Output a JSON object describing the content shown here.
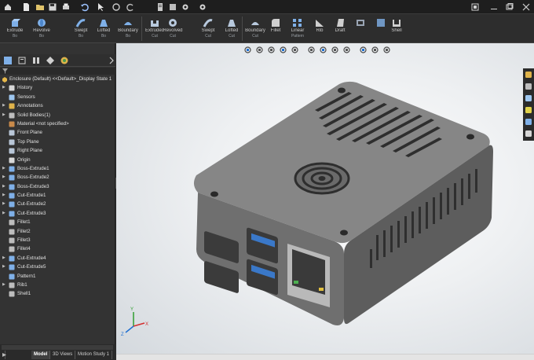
{
  "titlebar": {
    "icons": [
      "home-icon",
      "new-document-icon",
      "open-folder-icon",
      "save-icon",
      "print-icon",
      "undo-icon",
      "select-icon",
      "rebuild-icon",
      "file-properties-icon",
      "options-icon",
      "settings-gear-icon"
    ],
    "window_controls": [
      "restore-icon",
      "minimize-icon",
      "maximize-icon",
      "close-icon"
    ]
  },
  "ribbon": {
    "buttons": [
      {
        "label": "Extrude",
        "sub": "Bo",
        "icon": "extrude-icon"
      },
      {
        "label": "Revolve",
        "sub": "Bo",
        "icon": "revolve-icon"
      },
      {
        "label": "Swept",
        "sub": "Bo",
        "icon": "sweep-icon"
      },
      {
        "label": "Lofted",
        "sub": "Bo",
        "icon": "loft-icon"
      },
      {
        "label": "Boundary",
        "sub": "Bo",
        "icon": "boundary-icon"
      },
      {
        "label": "Extruded",
        "sub": "Cut",
        "icon": "extruded-cut-icon"
      },
      {
        "label": "Revolved",
        "sub": "Cut",
        "icon": "revolved-cut-icon"
      },
      {
        "label": "Swept",
        "sub": "Cut",
        "icon": "swept-cut-icon"
      },
      {
        "label": "Lofted",
        "sub": "Cut",
        "icon": "lofted-cut-icon"
      },
      {
        "label": "Boundary",
        "sub": "Cut",
        "icon": "boundary-cut-icon"
      },
      {
        "label": "Fillet",
        "sub": "",
        "icon": "fillet-icon"
      },
      {
        "label": "Linear",
        "sub": "Pattern",
        "icon": "linear-pattern-icon"
      },
      {
        "label": "Rib",
        "sub": "",
        "icon": "rib-icon"
      },
      {
        "label": "Draft",
        "sub": "",
        "icon": "draft-icon"
      },
      {
        "label": "Shell",
        "sub": "",
        "icon": "shell-icon"
      }
    ]
  },
  "feature_manager": {
    "tab_icons": [
      "featuremanager-tree-icon",
      "propertymanager-icon",
      "configurationmanager-icon",
      "dimxpert-icon",
      "display-manager-icon"
    ],
    "root_label": "Enclosure (Default) <<Default>_Display State 1",
    "tree": [
      {
        "label": "History",
        "icon": "history-icon",
        "expand": true
      },
      {
        "label": "Sensors",
        "icon": "sensor-icon",
        "expand": false
      },
      {
        "label": "Annotations",
        "icon": "annotation-icon",
        "expand": true
      },
      {
        "label": "Solid Bodies(1)",
        "icon": "solid-bodies-icon",
        "expand": true
      },
      {
        "label": "Material <not specified>",
        "icon": "material-icon",
        "expand": false
      },
      {
        "label": "Front Plane",
        "icon": "plane-icon",
        "expand": false
      },
      {
        "label": "Top Plane",
        "icon": "plane-icon",
        "expand": false
      },
      {
        "label": "Right Plane",
        "icon": "plane-icon",
        "expand": false
      },
      {
        "label": "Origin",
        "icon": "origin-icon",
        "expand": false
      },
      {
        "label": "Boss-Extrude1",
        "icon": "boss-extrude-icon",
        "expand": true
      },
      {
        "label": "Boss-Extrude2",
        "icon": "boss-extrude-icon",
        "expand": true
      },
      {
        "label": "Boss-Extrude3",
        "icon": "boss-extrude-icon",
        "expand": true
      },
      {
        "label": "Cut-Extrude1",
        "icon": "cut-extrude-icon",
        "expand": true
      },
      {
        "label": "Cut-Extrude2",
        "icon": "cut-extrude-icon",
        "expand": true
      },
      {
        "label": "Cut-Extrude3",
        "icon": "cut-extrude-icon",
        "expand": true
      },
      {
        "label": "Fillet1",
        "icon": "fillet-feature-icon",
        "expand": false
      },
      {
        "label": "Fillet2",
        "icon": "fillet-feature-icon",
        "expand": false
      },
      {
        "label": "Fillet3",
        "icon": "fillet-feature-icon",
        "expand": false
      },
      {
        "label": "Fillet4",
        "icon": "fillet-feature-icon",
        "expand": false
      },
      {
        "label": "Cut-Extrude4",
        "icon": "cut-extrude-icon",
        "expand": true
      },
      {
        "label": "Cut-Extrude5",
        "icon": "cut-extrude-icon",
        "expand": true
      },
      {
        "label": "Pattern1",
        "icon": "pattern-icon",
        "expand": false
      },
      {
        "label": "Rib1",
        "icon": "rib-feature-icon",
        "expand": true
      },
      {
        "label": "Shell1",
        "icon": "shell-feature-icon",
        "expand": false
      }
    ],
    "bottom_tabs": [
      "Model",
      "3D Views",
      "Motion Study 1"
    ]
  },
  "viewport": {
    "hud_icons": [
      "zoom-to-fit-icon",
      "zoom-to-area-icon",
      "previous-view-icon",
      "section-view-icon",
      "dynamic-annotation-icon",
      "view-orientation-icon",
      "display-style-icon",
      "hide-show-items-icon",
      "edit-appearance-icon",
      "apply-scene-icon",
      "view-settings-icon",
      "display-pane-icon"
    ],
    "taskpane_icons": [
      "solidworks-resources-icon",
      "design-library-icon",
      "file-explorer-icon",
      "view-palette-icon",
      "appearances-icon",
      "custom-properties-icon"
    ],
    "triad": {
      "x": "X",
      "y": "Y",
      "z": "Z"
    }
  },
  "colors": {
    "accent": "#1f6fd1",
    "part_body": "#7a7a7a",
    "usb3_blue": "#3a78c8",
    "panel_bg": "#333333",
    "ribbon_bg": "#2d2d2d"
  }
}
